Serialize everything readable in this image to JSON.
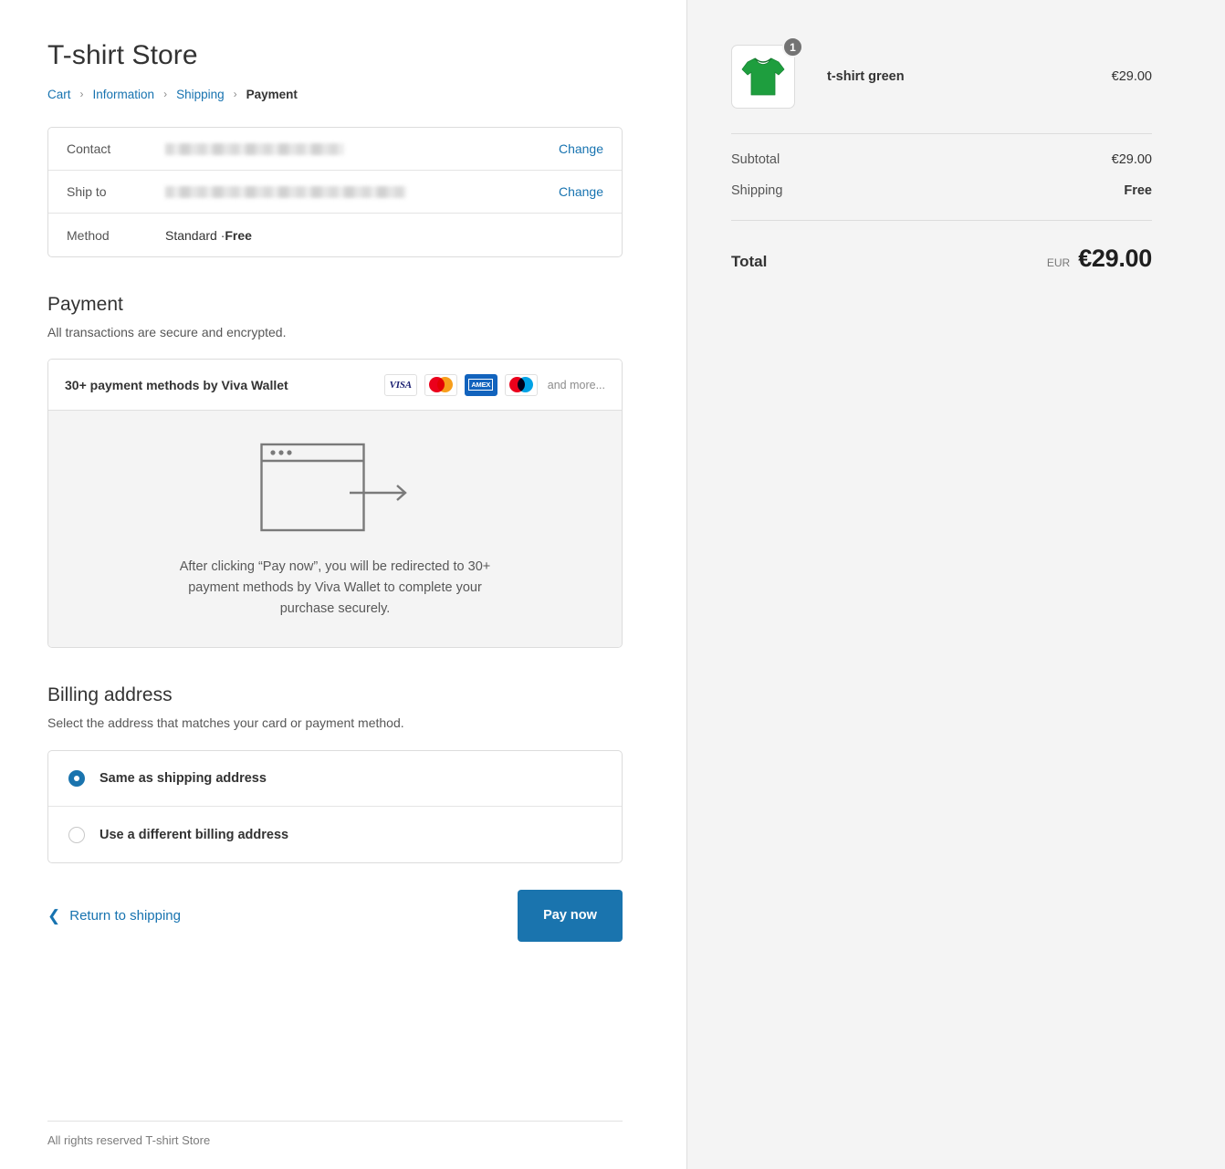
{
  "store": {
    "title": "T-shirt Store",
    "footer": "All rights reserved T-shirt Store"
  },
  "breadcrumb": {
    "items": [
      {
        "label": "Cart",
        "current": false
      },
      {
        "label": "Information",
        "current": false
      },
      {
        "label": "Shipping",
        "current": false
      },
      {
        "label": "Payment",
        "current": true
      }
    ],
    "separator": "›"
  },
  "review": {
    "contact": {
      "label": "Contact",
      "value": "",
      "redacted": true,
      "change_label": "Change"
    },
    "ship_to": {
      "label": "Ship to",
      "value": "",
      "redacted": true,
      "change_label": "Change"
    },
    "method": {
      "label": "Method",
      "value_prefix": "Standard · ",
      "value_strong": "Free"
    }
  },
  "payment": {
    "heading": "Payment",
    "subheading": "All transactions are secure and encrypted.",
    "provider_title": "30+ payment methods by Viva Wallet",
    "card_brands": [
      {
        "name": "visa-icon",
        "label": "VISA"
      },
      {
        "name": "mastercard-icon",
        "label": "Mastercard"
      },
      {
        "name": "amex-icon",
        "label": "AMEX"
      },
      {
        "name": "maestro-icon",
        "label": "Maestro"
      }
    ],
    "and_more": "and more...",
    "redirect_notice": "After clicking “Pay now”, you will be redirected to 30+ payment methods by Viva Wallet to complete your purchase securely."
  },
  "billing": {
    "heading": "Billing address",
    "subheading": "Select the address that matches your card or payment method.",
    "options": [
      {
        "label": "Same as shipping address",
        "selected": true
      },
      {
        "label": "Use a different billing address",
        "selected": false
      }
    ]
  },
  "actions": {
    "return_label": "Return to shipping",
    "pay_label": "Pay now"
  },
  "summary": {
    "item": {
      "name": "t-shirt green",
      "price": "€29.00",
      "quantity": "1"
    },
    "subtotal": {
      "label": "Subtotal",
      "value": "€29.00"
    },
    "shipping": {
      "label": "Shipping",
      "value": "Free"
    },
    "total": {
      "label": "Total",
      "currency": "EUR",
      "amount": "€29.00"
    }
  },
  "colors": {
    "link": "#1773b0",
    "primary_button": "#1a74ae",
    "sidebar_bg": "#f4f4f4",
    "shirt_green": "#1e9e3e",
    "badge_gray": "#737373"
  }
}
